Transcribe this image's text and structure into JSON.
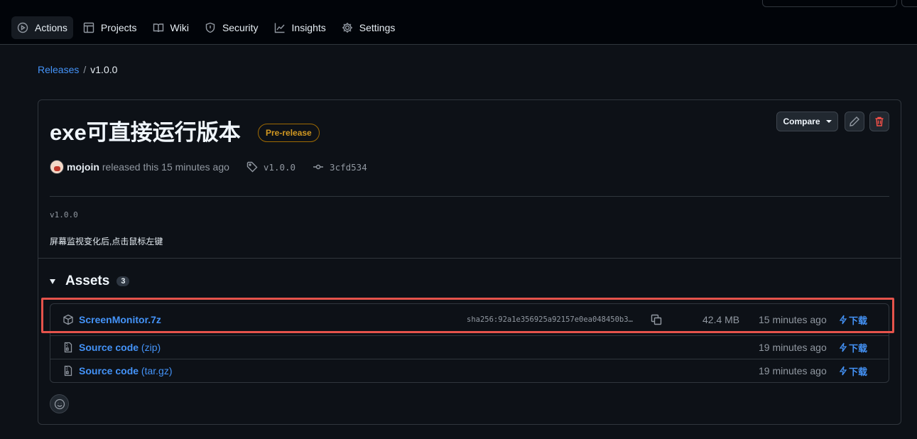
{
  "nav": {
    "tabs": [
      {
        "label": "Actions",
        "icon": "play-circle-icon",
        "active": true
      },
      {
        "label": "Projects",
        "icon": "table-icon",
        "active": false
      },
      {
        "label": "Wiki",
        "icon": "book-icon",
        "active": false
      },
      {
        "label": "Security",
        "icon": "shield-icon",
        "active": false
      },
      {
        "label": "Insights",
        "icon": "graph-icon",
        "active": false
      },
      {
        "label": "Settings",
        "icon": "gear-icon",
        "active": false
      }
    ]
  },
  "breadcrumb": {
    "parent": "Releases",
    "separator": "/",
    "current": "v1.0.0"
  },
  "release": {
    "title": "exe可直接运行版本",
    "badge": "Pre-release",
    "compare_label": "Compare",
    "author": "mojoin",
    "released_text": "released this 15 minutes ago",
    "tag": "v1.0.0",
    "commit": "3cfd534",
    "body_tag": "v1.0.0",
    "body_text": "屏幕监视变化后,点击鼠标左键"
  },
  "assets": {
    "title": "Assets",
    "count": "3",
    "items": [
      {
        "name": "ScreenMonitor.7z",
        "suffix": "",
        "sha": "sha256:92a1e356925a92157e0ea048450b3…",
        "size": "42.4 MB",
        "time": "15 minutes ago",
        "download": "下载"
      },
      {
        "name": "Source code",
        "suffix": " (zip)",
        "sha": "",
        "size": "",
        "time": "19 minutes ago",
        "download": "下载"
      },
      {
        "name": "Source code",
        "suffix": " (tar.gz)",
        "sha": "",
        "size": "",
        "time": "19 minutes ago",
        "download": "下载"
      }
    ]
  },
  "colors": {
    "background": "#0d1117",
    "accent": "#4493f8",
    "prerelease": "#d29922",
    "highlight": "#e5534b",
    "delete": "#f85149"
  }
}
